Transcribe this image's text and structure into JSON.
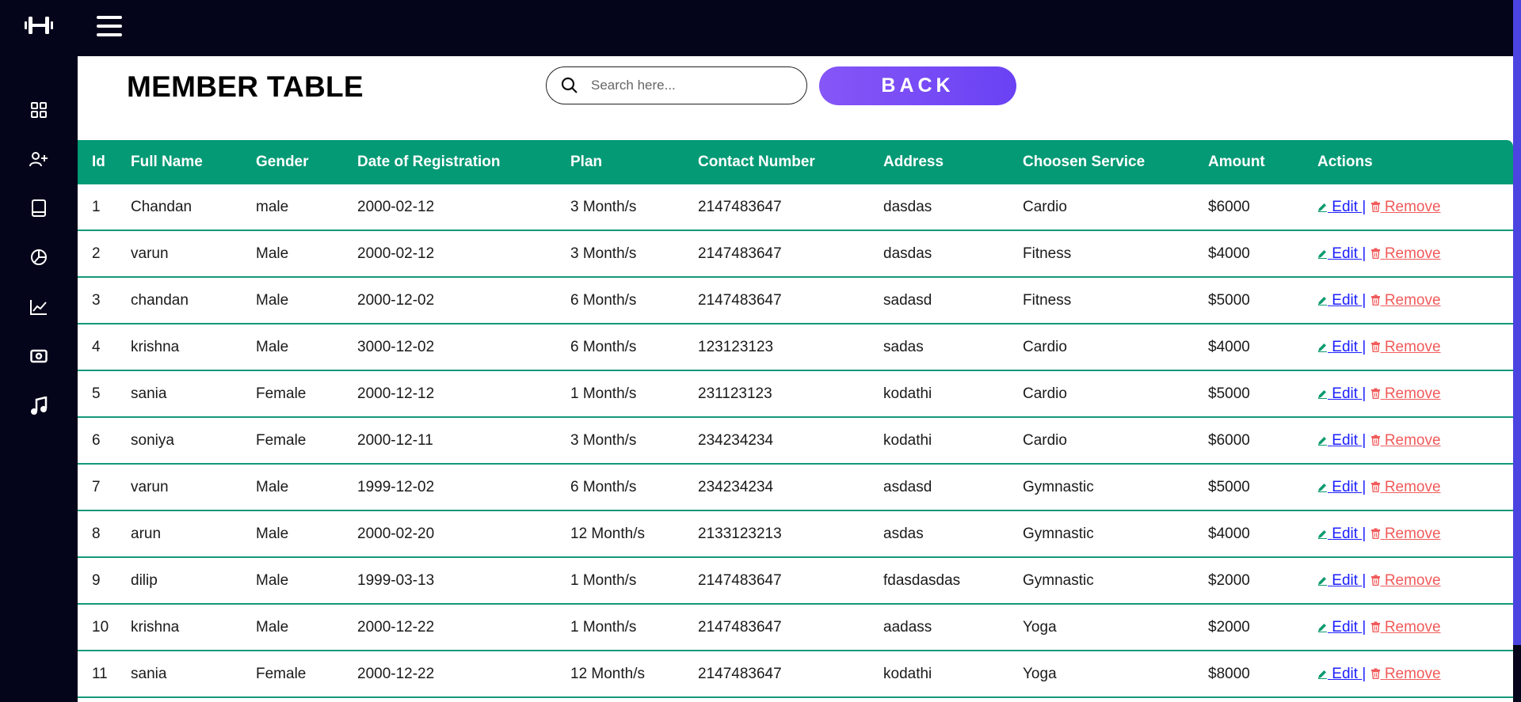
{
  "app": {
    "logo_icon": "dumbbell-icon",
    "menu_icon": "hamburger-icon",
    "colors": {
      "sidebar": "#04041a",
      "header_row": "#039a75",
      "back_button": "#7c4df6",
      "edit": "#1d20ff",
      "remove": "#f15a5a"
    }
  },
  "sidebar": {
    "items": [
      {
        "icon": "dashboard-grid-icon"
      },
      {
        "icon": "add-user-icon"
      },
      {
        "icon": "book-icon"
      },
      {
        "icon": "pie-chart-icon"
      },
      {
        "icon": "line-chart-icon"
      },
      {
        "icon": "money-icon"
      },
      {
        "icon": "music-icon"
      }
    ]
  },
  "page": {
    "title": "MEMBER TABLE",
    "search_placeholder": "Search here...",
    "back_label": "BACK"
  },
  "table": {
    "columns": [
      "Id",
      "Full Name",
      "Gender",
      "Date of Registration",
      "Plan",
      "Contact Number",
      "Address",
      "Choosen Service",
      "Amount",
      "Actions"
    ],
    "edit_label": "Edit",
    "separator": "|",
    "remove_label": "Remove",
    "rows": [
      [
        "1",
        "Chandan",
        "male",
        "2000-02-12",
        "3 Month/s",
        "2147483647",
        "dasdas",
        "Cardio",
        "$6000"
      ],
      [
        "2",
        "varun",
        "Male",
        "2000-02-12",
        "3 Month/s",
        "2147483647",
        "dasdas",
        "Fitness",
        "$4000"
      ],
      [
        "3",
        "chandan",
        "Male",
        "2000-12-02",
        "6 Month/s",
        "2147483647",
        "sadasd",
        "Fitness",
        "$5000"
      ],
      [
        "4",
        "krishna",
        "Male",
        "3000-12-02",
        "6 Month/s",
        "123123123",
        "sadas",
        "Cardio",
        "$4000"
      ],
      [
        "5",
        "sania",
        "Female",
        "2000-12-12",
        "1 Month/s",
        "231123123",
        "kodathi",
        "Cardio",
        "$5000"
      ],
      [
        "6",
        "soniya",
        "Female",
        "2000-12-11",
        "3 Month/s",
        "234234234",
        "kodathi",
        "Cardio",
        "$6000"
      ],
      [
        "7",
        "varun",
        "Male",
        "1999-12-02",
        "6 Month/s",
        "234234234",
        "asdasd",
        "Gymnastic",
        "$5000"
      ],
      [
        "8",
        "arun",
        "Male",
        "2000-02-20",
        "12 Month/s",
        "2133123213",
        "asdas",
        "Gymnastic",
        "$4000"
      ],
      [
        "9",
        "dilip",
        "Male",
        "1999-03-13",
        "1 Month/s",
        "2147483647",
        "fdasdasdas",
        "Gymnastic",
        "$2000"
      ],
      [
        "10",
        "krishna",
        "Male",
        "2000-12-22",
        "1 Month/s",
        "2147483647",
        "aadass",
        "Yoga",
        "$2000"
      ],
      [
        "11",
        "sania",
        "Female",
        "2000-12-22",
        "12 Month/s",
        "2147483647",
        "kodathi",
        "Yoga",
        "$8000"
      ]
    ]
  }
}
